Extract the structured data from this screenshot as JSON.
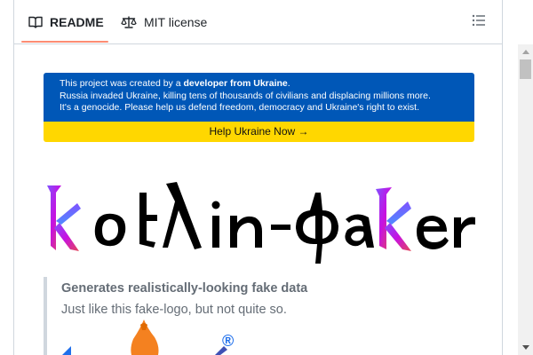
{
  "tabs": [
    {
      "label": "README",
      "icon": "book-icon",
      "active": true
    },
    {
      "label": "MIT license",
      "icon": "scale-icon",
      "active": false
    }
  ],
  "outline_icon": "list-icon",
  "banner": {
    "line1_prefix": "This project was created by a ",
    "line1_bold": "developer from Ukraine",
    "line1_suffix": ".",
    "line2": "Russia invaded Ukraine, killing tens of thousands of civilians and displacing millions more.",
    "line3": "It's a genocide. Please help us defend freedom, democracy and Ukraine's right to exist.",
    "cta": "Help Ukraine Now →",
    "colors": {
      "blue": "#0057b7",
      "yellow": "#ffd700"
    }
  },
  "logo": {
    "alt": "kotlin-faker",
    "icon": "kotlin-faker-logo"
  },
  "quote": {
    "title": "Generates realistically-looking fake data",
    "text": "Just like this fake-logo, but not quite so."
  },
  "fake_logo": {
    "mark": "®"
  },
  "colors": {
    "tab_underline": "#fd8c73",
    "border": "#d0d7de",
    "muted_text": "#656d76"
  }
}
